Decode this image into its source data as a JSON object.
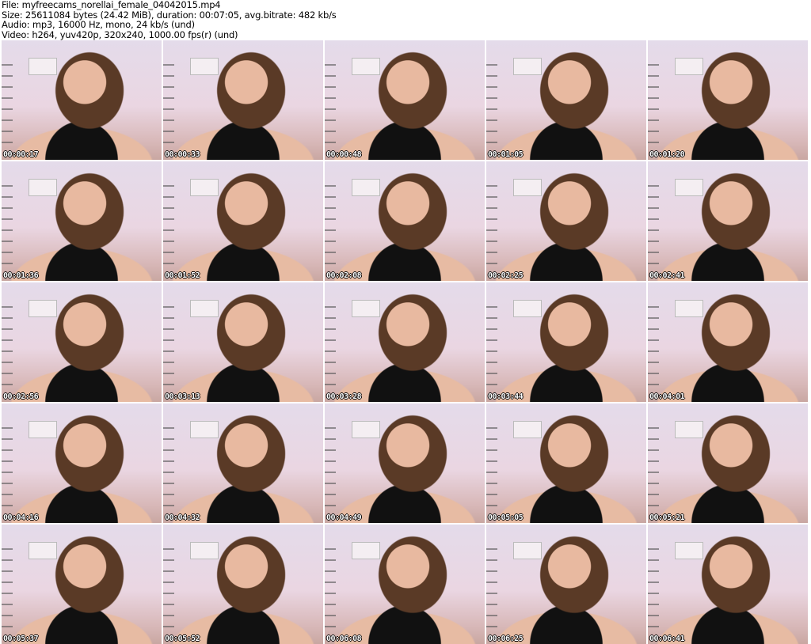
{
  "header": {
    "file": "File: myfreecams_norellai_female_04042015.mp4",
    "size": "Size: 25611084 bytes (24.42 MiB), duration: 00:07:05, avg.bitrate: 482 kb/s",
    "audio": "Audio: mp3, 16000 Hz, mono, 24 kb/s (und)",
    "video": "Video: h264, yuv420p, 320x240, 1000.00 fps(r) (und)"
  },
  "thumbnails": [
    {
      "timestamp": "00:00:17"
    },
    {
      "timestamp": "00:00:33"
    },
    {
      "timestamp": "00:00:48"
    },
    {
      "timestamp": "00:01:05"
    },
    {
      "timestamp": "00:01:20"
    },
    {
      "timestamp": "00:01:36"
    },
    {
      "timestamp": "00:01:52"
    },
    {
      "timestamp": "00:02:08"
    },
    {
      "timestamp": "00:02:25"
    },
    {
      "timestamp": "00:02:41"
    },
    {
      "timestamp": "00:02:56"
    },
    {
      "timestamp": "00:03:13"
    },
    {
      "timestamp": "00:03:28"
    },
    {
      "timestamp": "00:03:44"
    },
    {
      "timestamp": "00:04:01"
    },
    {
      "timestamp": "00:04:16"
    },
    {
      "timestamp": "00:04:32"
    },
    {
      "timestamp": "00:04:49"
    },
    {
      "timestamp": "00:05:05"
    },
    {
      "timestamp": "00:05:21"
    },
    {
      "timestamp": "00:05:37"
    },
    {
      "timestamp": "00:05:52"
    },
    {
      "timestamp": "00:06:08"
    },
    {
      "timestamp": "00:06:25"
    },
    {
      "timestamp": "00:06:41"
    }
  ]
}
